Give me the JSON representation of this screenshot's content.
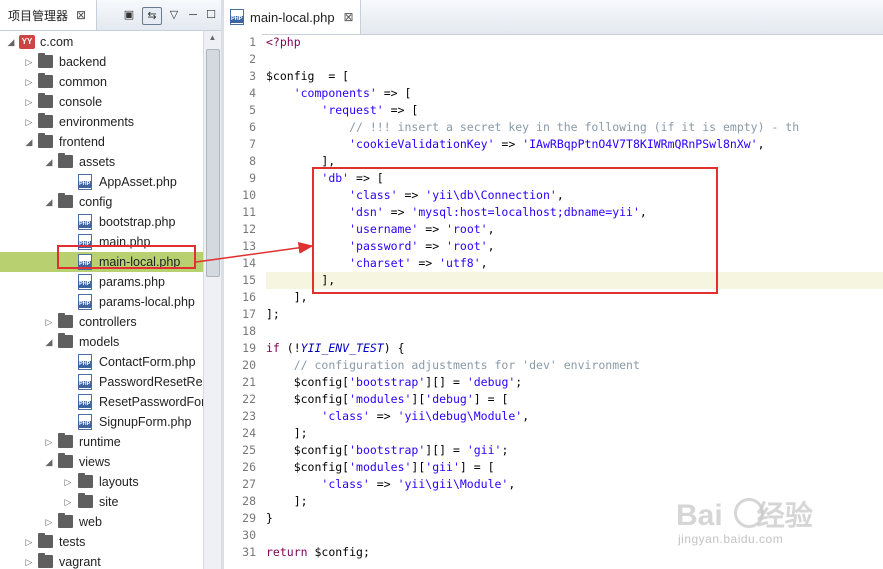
{
  "left_panel": {
    "tab_title": "项目管理器",
    "tab_close": "⊠",
    "toolbar": {
      "collapse": "▣",
      "link": "⇆",
      "menu": "▽",
      "minimize": "─",
      "maximize": "☐"
    },
    "tree": [
      {
        "label": "c.com",
        "depth": 0,
        "expanded": true,
        "type": "project"
      },
      {
        "label": "backend",
        "depth": 1,
        "expanded": false,
        "type": "folder"
      },
      {
        "label": "common",
        "depth": 1,
        "expanded": false,
        "type": "folder"
      },
      {
        "label": "console",
        "depth": 1,
        "expanded": false,
        "type": "folder"
      },
      {
        "label": "environments",
        "depth": 1,
        "expanded": false,
        "type": "folder"
      },
      {
        "label": "frontend",
        "depth": 1,
        "expanded": true,
        "type": "folder"
      },
      {
        "label": "assets",
        "depth": 2,
        "expanded": true,
        "type": "folder"
      },
      {
        "label": "AppAsset.php",
        "depth": 3,
        "type": "php"
      },
      {
        "label": "config",
        "depth": 2,
        "expanded": true,
        "type": "folder"
      },
      {
        "label": "bootstrap.php",
        "depth": 3,
        "type": "php"
      },
      {
        "label": "main.php",
        "depth": 3,
        "type": "php"
      },
      {
        "label": "main-local.php",
        "depth": 3,
        "type": "php",
        "selected": true
      },
      {
        "label": "params.php",
        "depth": 3,
        "type": "php"
      },
      {
        "label": "params-local.php",
        "depth": 3,
        "type": "php"
      },
      {
        "label": "controllers",
        "depth": 2,
        "expanded": false,
        "type": "folder"
      },
      {
        "label": "models",
        "depth": 2,
        "expanded": true,
        "type": "folder"
      },
      {
        "label": "ContactForm.php",
        "depth": 3,
        "type": "php"
      },
      {
        "label": "PasswordResetRe",
        "depth": 3,
        "type": "php"
      },
      {
        "label": "ResetPasswordFor",
        "depth": 3,
        "type": "php"
      },
      {
        "label": "SignupForm.php",
        "depth": 3,
        "type": "php"
      },
      {
        "label": "runtime",
        "depth": 2,
        "expanded": false,
        "type": "folder"
      },
      {
        "label": "views",
        "depth": 2,
        "expanded": true,
        "type": "folder"
      },
      {
        "label": "layouts",
        "depth": 3,
        "expanded": false,
        "type": "folder"
      },
      {
        "label": "site",
        "depth": 3,
        "expanded": false,
        "type": "folder"
      },
      {
        "label": "web",
        "depth": 2,
        "expanded": false,
        "type": "folder"
      },
      {
        "label": "tests",
        "depth": 1,
        "expanded": false,
        "type": "folder"
      },
      {
        "label": "vagrant",
        "depth": 1,
        "expanded": false,
        "type": "folder"
      }
    ]
  },
  "editor": {
    "tab_title": "main-local.php",
    "tab_close": "⊠",
    "highlight_line": 15,
    "lines": [
      [
        [
          "kw",
          "<?php"
        ]
      ],
      [],
      [
        [
          "var",
          "$config"
        ],
        [
          "",
          "  = ["
        ]
      ],
      [
        [
          "",
          "    "
        ],
        [
          "str",
          "'components'"
        ],
        [
          "",
          " => ["
        ]
      ],
      [
        [
          "",
          "        "
        ],
        [
          "str",
          "'request'"
        ],
        [
          "",
          " => ["
        ]
      ],
      [
        [
          "",
          "            "
        ],
        [
          "cm",
          "// !!! insert a secret key in the following (if it is empty) - th"
        ]
      ],
      [
        [
          "",
          "            "
        ],
        [
          "str",
          "'cookieValidationKey'"
        ],
        [
          "",
          " => "
        ],
        [
          "str",
          "'IAwRBqpPtnO4V7T8KIWRmQRnPSwl8nXw'"
        ],
        [
          "",
          ","
        ]
      ],
      [
        [
          "",
          "        ],"
        ]
      ],
      [
        [
          "",
          "        "
        ],
        [
          "str",
          "'db'"
        ],
        [
          "",
          " => ["
        ]
      ],
      [
        [
          "",
          "            "
        ],
        [
          "str",
          "'class'"
        ],
        [
          "",
          " => "
        ],
        [
          "str",
          "'yii\\db\\Connection'"
        ],
        [
          "",
          ","
        ]
      ],
      [
        [
          "",
          "            "
        ],
        [
          "str",
          "'dsn'"
        ],
        [
          "",
          " => "
        ],
        [
          "str",
          "'mysql:host=localhost;dbname=yii'"
        ],
        [
          "",
          ","
        ]
      ],
      [
        [
          "",
          "            "
        ],
        [
          "str",
          "'username'"
        ],
        [
          "",
          " => "
        ],
        [
          "str",
          "'root'"
        ],
        [
          "",
          ","
        ]
      ],
      [
        [
          "",
          "            "
        ],
        [
          "str",
          "'password'"
        ],
        [
          "",
          " => "
        ],
        [
          "str",
          "'root'"
        ],
        [
          "",
          ","
        ]
      ],
      [
        [
          "",
          "            "
        ],
        [
          "str",
          "'charset'"
        ],
        [
          "",
          " => "
        ],
        [
          "str",
          "'utf8'"
        ],
        [
          "",
          ","
        ]
      ],
      [
        [
          "",
          "        ],"
        ]
      ],
      [
        [
          "",
          "    ],"
        ]
      ],
      [
        [
          "",
          "];"
        ]
      ],
      [],
      [
        [
          "kw",
          "if"
        ],
        [
          "",
          " (!"
        ],
        [
          "const",
          "YII_ENV_TEST"
        ],
        [
          "",
          ") {"
        ]
      ],
      [
        [
          "",
          "    "
        ],
        [
          "cm",
          "// configuration adjustments for 'dev' environment"
        ]
      ],
      [
        [
          "",
          "    "
        ],
        [
          "var",
          "$config"
        ],
        [
          "",
          "["
        ],
        [
          "str",
          "'bootstrap'"
        ],
        [
          "",
          "][] = "
        ],
        [
          "str",
          "'debug'"
        ],
        [
          "",
          ";"
        ]
      ],
      [
        [
          "",
          "    "
        ],
        [
          "var",
          "$config"
        ],
        [
          "",
          "["
        ],
        [
          "str",
          "'modules'"
        ],
        [
          "",
          "]["
        ],
        [
          "str",
          "'debug'"
        ],
        [
          "",
          "] = ["
        ]
      ],
      [
        [
          "",
          "        "
        ],
        [
          "str",
          "'class'"
        ],
        [
          "",
          " => "
        ],
        [
          "str",
          "'yii\\debug\\Module'"
        ],
        [
          "",
          ","
        ]
      ],
      [
        [
          "",
          "    ];"
        ]
      ],
      [
        [
          "",
          "    "
        ],
        [
          "var",
          "$config"
        ],
        [
          "",
          "["
        ],
        [
          "str",
          "'bootstrap'"
        ],
        [
          "",
          "][] = "
        ],
        [
          "str",
          "'gii'"
        ],
        [
          "",
          ";"
        ]
      ],
      [
        [
          "",
          "    "
        ],
        [
          "var",
          "$config"
        ],
        [
          "",
          "["
        ],
        [
          "str",
          "'modules'"
        ],
        [
          "",
          "]["
        ],
        [
          "str",
          "'gii'"
        ],
        [
          "",
          "] = ["
        ]
      ],
      [
        [
          "",
          "        "
        ],
        [
          "str",
          "'class'"
        ],
        [
          "",
          " => "
        ],
        [
          "str",
          "'yii\\gii\\Module'"
        ],
        [
          "",
          ","
        ]
      ],
      [
        [
          "",
          "    ];"
        ]
      ],
      [
        [
          "",
          "}"
        ]
      ],
      [],
      [
        [
          "kw",
          "return"
        ],
        [
          "",
          " "
        ],
        [
          "var",
          "$config"
        ],
        [
          "",
          ";"
        ]
      ]
    ]
  },
  "annotation": {
    "color": "#e03030"
  },
  "watermark": {
    "brand": "Bai",
    "brand_suffix": "经验",
    "url": "jingyan.baidu.com"
  }
}
